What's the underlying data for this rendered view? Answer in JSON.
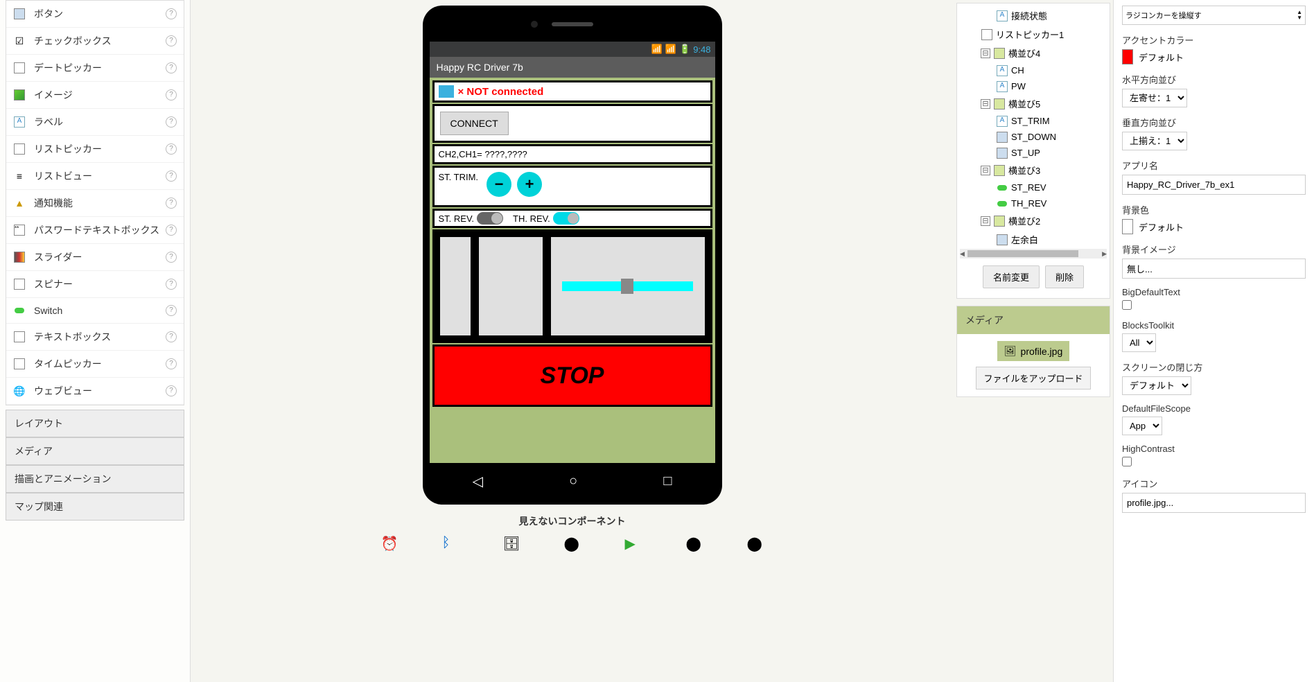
{
  "palette": {
    "items": [
      {
        "label": "ボタン",
        "icon": "🔲"
      },
      {
        "label": "チェックボックス",
        "icon": "☑"
      },
      {
        "label": "デートピッカー",
        "icon": "📅"
      },
      {
        "label": "イメージ",
        "icon": "🖼"
      },
      {
        "label": "ラベル",
        "icon": "A"
      },
      {
        "label": "リストピッカー",
        "icon": "📋"
      },
      {
        "label": "リストビュー",
        "icon": "≡"
      },
      {
        "label": "通知機能",
        "icon": "⚠"
      },
      {
        "label": "パスワードテキストボックス",
        "icon": "**"
      },
      {
        "label": "スライダー",
        "icon": "📊"
      },
      {
        "label": "スピナー",
        "icon": "🗄"
      },
      {
        "label": "Switch",
        "icon": "⬤"
      },
      {
        "label": "テキストボックス",
        "icon": "📝"
      },
      {
        "label": "タイムピッカー",
        "icon": "🕐"
      },
      {
        "label": "ウェブビュー",
        "icon": "🌐"
      }
    ],
    "categories": [
      "レイアウト",
      "メディア",
      "描画とアニメーション",
      "マップ関連"
    ]
  },
  "phone": {
    "time": "9:48",
    "appTitle": "Happy RC Driver 7b",
    "notConnected": "× NOT connected",
    "connect": "CONNECT",
    "chLine": "CH2,CH1=    ????,????",
    "stTrim": "ST. TRIM.",
    "stRev": "ST. REV.",
    "thRev": "TH. REV.",
    "stop": "STOP",
    "hiddenLabel": "見えないコンポーネント"
  },
  "tree": {
    "items": [
      {
        "label": "接続状態",
        "indent": 2,
        "icon": "A"
      },
      {
        "label": "リストピッカー1",
        "indent": 1,
        "icon": "list"
      },
      {
        "label": "横並び4",
        "indent": 1,
        "icon": "layout",
        "expand": true
      },
      {
        "label": "CH",
        "indent": 2,
        "icon": "A"
      },
      {
        "label": "PW",
        "indent": 2,
        "icon": "A"
      },
      {
        "label": "横並び5",
        "indent": 1,
        "icon": "layout",
        "expand": true
      },
      {
        "label": "ST_TRIM",
        "indent": 2,
        "icon": "A"
      },
      {
        "label": "ST_DOWN",
        "indent": 2,
        "icon": "btn"
      },
      {
        "label": "ST_UP",
        "indent": 2,
        "icon": "btn"
      },
      {
        "label": "横並び3",
        "indent": 1,
        "icon": "layout",
        "expand": true
      },
      {
        "label": "ST_REV",
        "indent": 2,
        "icon": "switch"
      },
      {
        "label": "TH_REV",
        "indent": 2,
        "icon": "switch"
      },
      {
        "label": "横並び2",
        "indent": 1,
        "icon": "layout",
        "expand": true
      },
      {
        "label": "左余白",
        "indent": 2,
        "icon": "btn"
      }
    ],
    "rename": "名前変更",
    "delete": "削除"
  },
  "media": {
    "header": "メディア",
    "file": "profile.jpg",
    "upload": "ファイルをアップロード"
  },
  "props": {
    "aboutText": "ラジコンカーを操縦す",
    "accentLabel": "アクセントカラー",
    "accentValue": "デフォルト",
    "accentColor": "#ff0000",
    "hAlignLabel": "水平方向並び",
    "hAlignValue": "左寄せ：1",
    "vAlignLabel": "垂直方向並び",
    "vAlignValue": "上揃え：1",
    "appNameLabel": "アプリ名",
    "appNameValue": "Happy_RC_Driver_7b_ex1",
    "bgColorLabel": "背景色",
    "bgColorValue": "デフォルト",
    "bgImgLabel": "背景イメージ",
    "bgImgValue": "無し...",
    "bigDefLabel": "BigDefaultText",
    "blocksLabel": "BlocksToolkit",
    "blocksValue": "All",
    "closeLabel": "スクリーンの閉じ方",
    "closeValue": "デフォルト",
    "scopeLabel": "DefaultFileScope",
    "scopeValue": "App",
    "highContrastLabel": "HighContrast",
    "iconLabel": "アイコン",
    "iconValue": "profile.jpg..."
  }
}
